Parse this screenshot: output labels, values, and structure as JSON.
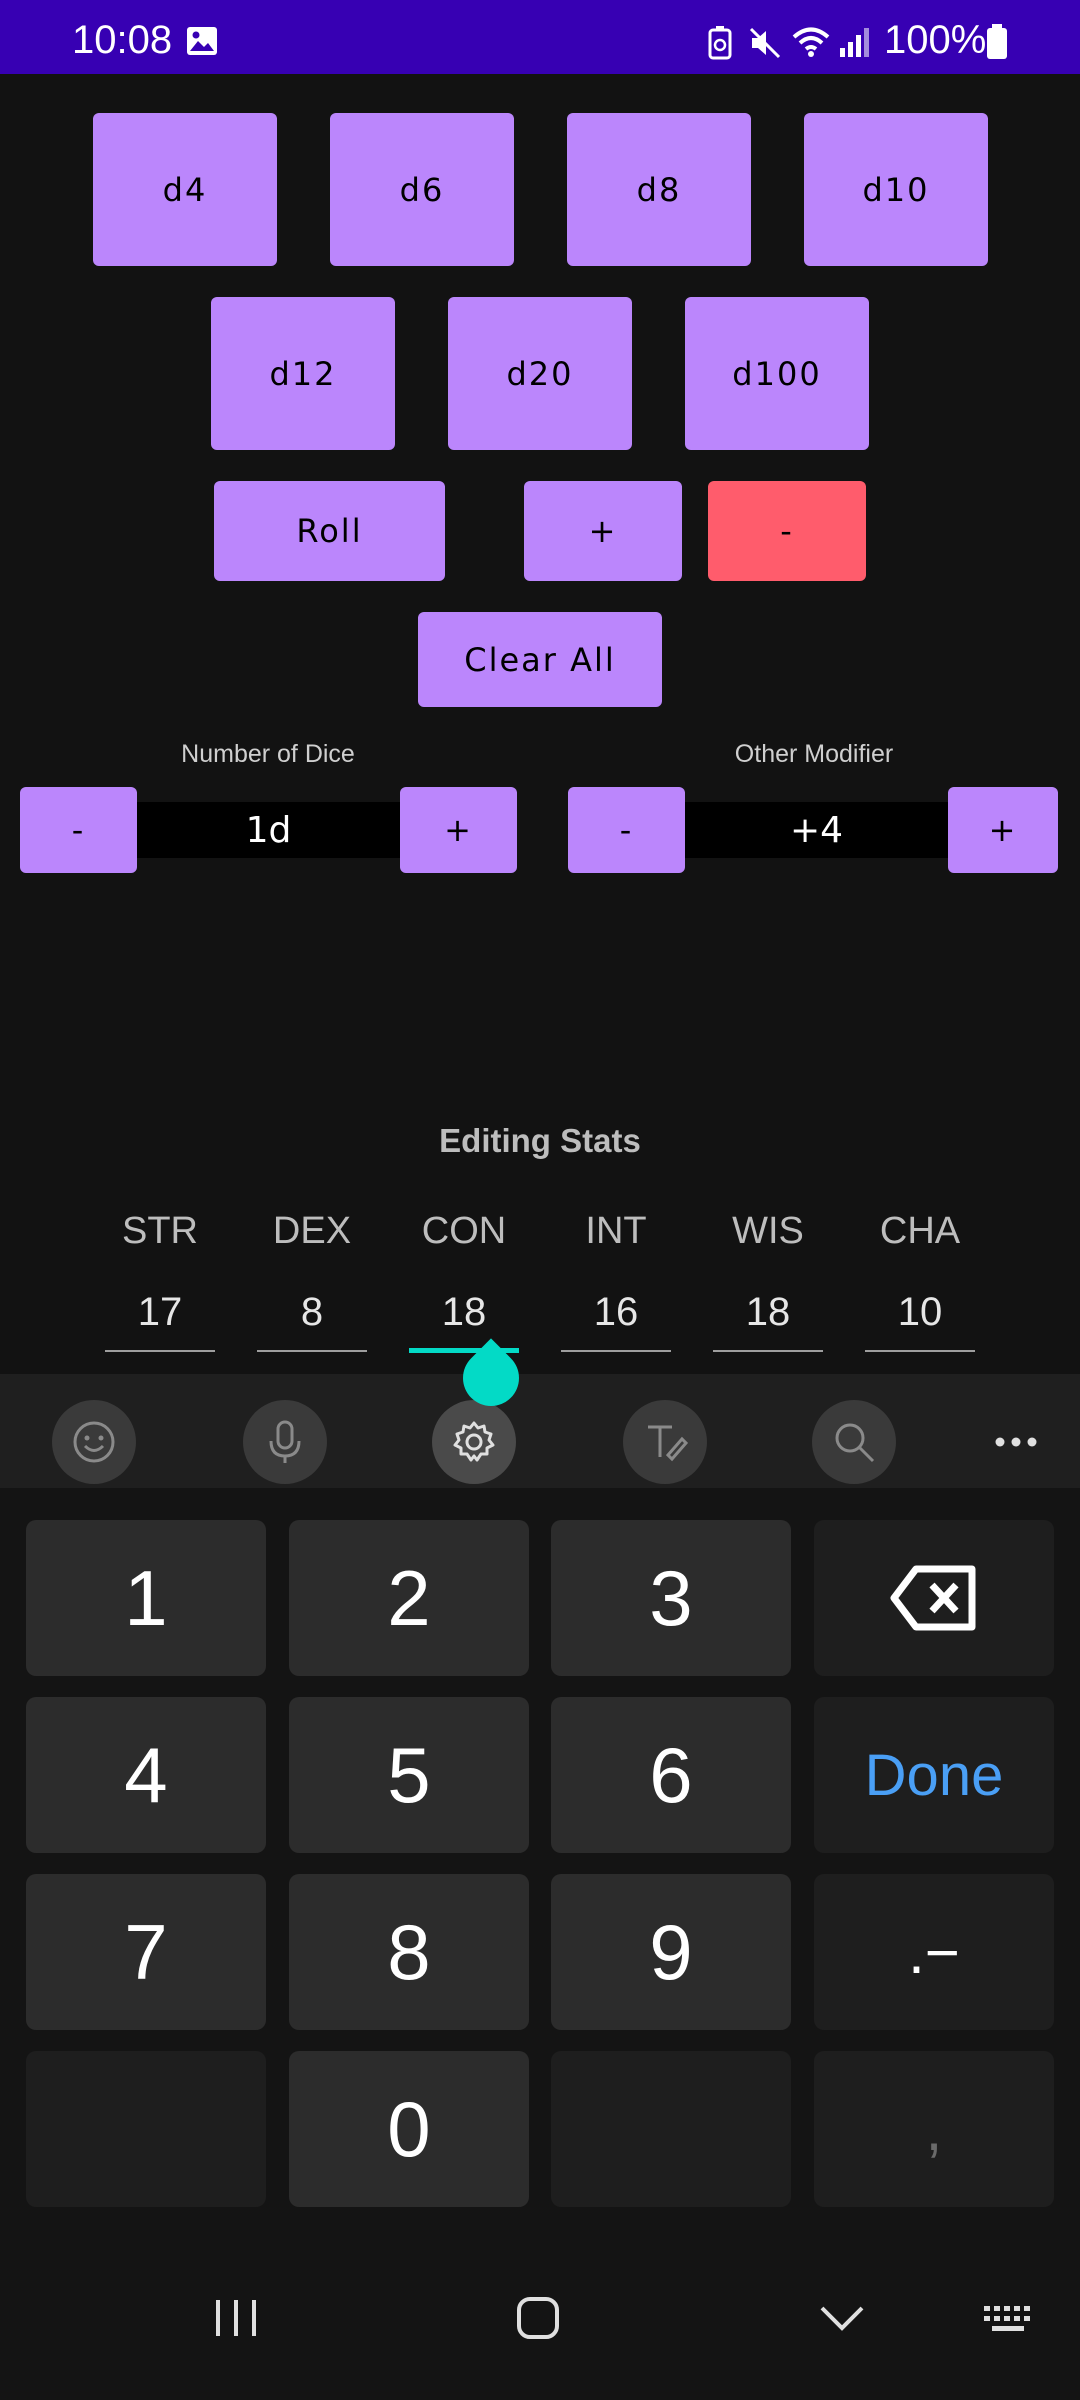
{
  "status_bar": {
    "time": "10:08",
    "battery": "100%",
    "icons": [
      "gallery-icon",
      "battery-saver-icon",
      "mute-icon",
      "wifi-icon",
      "signal-icon",
      "battery-icon"
    ],
    "background": "#3700b3"
  },
  "dice": {
    "row1": [
      "d4",
      "d6",
      "d8",
      "d10"
    ],
    "row2": [
      "d12",
      "d20",
      "d100"
    ]
  },
  "actions": {
    "roll": "Roll",
    "plus": "+",
    "minus": "-",
    "clear_all": "Clear All"
  },
  "counters": {
    "number_of_dice": {
      "label": "Number of Dice",
      "value": "1d",
      "minus": "-",
      "plus": "+"
    },
    "other_modifier": {
      "label": "Other Modifier",
      "value": "+4",
      "minus": "-",
      "plus": "+"
    }
  },
  "stats": {
    "title": "Editing Stats",
    "items": [
      {
        "name": "STR",
        "value": "17"
      },
      {
        "name": "DEX",
        "value": "8"
      },
      {
        "name": "CON",
        "value": "18"
      },
      {
        "name": "INT",
        "value": "16"
      },
      {
        "name": "WIS",
        "value": "18"
      },
      {
        "name": "CHA",
        "value": "10"
      }
    ],
    "focused": "CON"
  },
  "keyboard": {
    "toolbar": [
      "emoji-icon",
      "microphone-icon",
      "settings-icon",
      "handwriting-icon",
      "search-icon",
      "more-icon"
    ],
    "keys": {
      "k1": "1",
      "k2": "2",
      "k3": "3",
      "k4": "4",
      "k5": "5",
      "k6": "6",
      "k7": "7",
      "k8": "8",
      "k9": "9",
      "k0": "0",
      "done": "Done",
      "dot_minus": ".−",
      "comma": ","
    }
  },
  "nav_bar": [
    "recents-icon",
    "home-icon",
    "back-icon",
    "keyboard-icon"
  ],
  "colors": {
    "accent": "#bb86fc",
    "danger": "#ff5c6c",
    "focus": "#03dac6",
    "done_text": "#4a9ff5"
  }
}
